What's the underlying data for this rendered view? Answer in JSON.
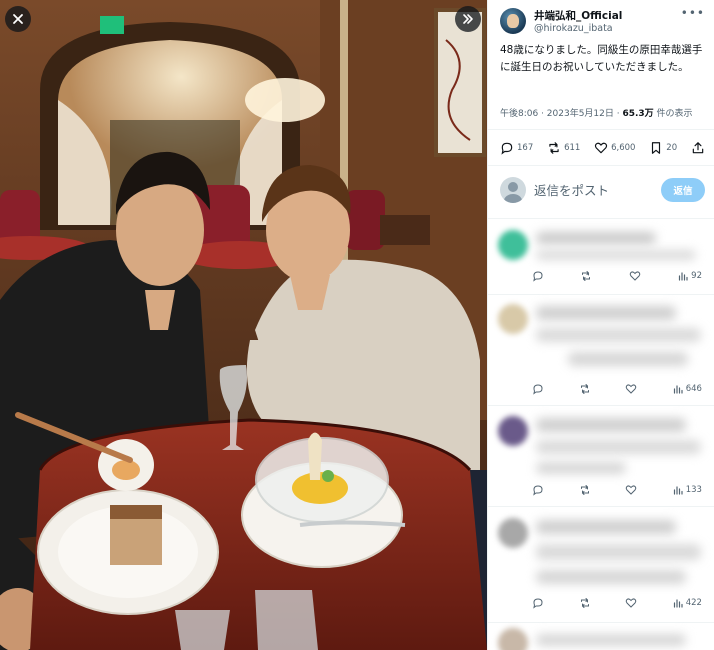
{
  "post": {
    "author_name": "井端弘和_Official",
    "handle": "@hirokazu_ibata",
    "text": "48歳になりました。同級生の原田幸哉選手に誕生日のお祝いしていただきました。",
    "timestamp": "午後8:06 · 2023年5月12日 · ",
    "views_count": "65.3万",
    "views_label": " 件の表示",
    "stats": {
      "replies": "167",
      "reposts": "611",
      "likes": "6,600",
      "bookmarks": "20"
    }
  },
  "reply_box": {
    "placeholder": "返信をポスト",
    "button_label": "返信"
  },
  "replies": [
    {
      "views": "92",
      "avatar_color": "#3fbf9a"
    },
    {
      "views": "646",
      "avatar_color": "#d8c9a8"
    },
    {
      "views": "133",
      "avatar_color": "#6a5a8a"
    },
    {
      "views": "422",
      "avatar_color": "#a8a8a8"
    }
  ],
  "icons": {
    "close": "close-icon",
    "expand": "double-chevron-right-icon",
    "more": "more-horizontal-icon",
    "reply": "reply-icon",
    "repost": "repost-icon",
    "like": "heart-icon",
    "bookmark": "bookmark-icon",
    "share": "share-icon",
    "views": "bar-chart-icon"
  },
  "colors": {
    "reply_button": "#8ecdf8",
    "secondary_text": "#536471",
    "divider": "#eff3f4"
  }
}
